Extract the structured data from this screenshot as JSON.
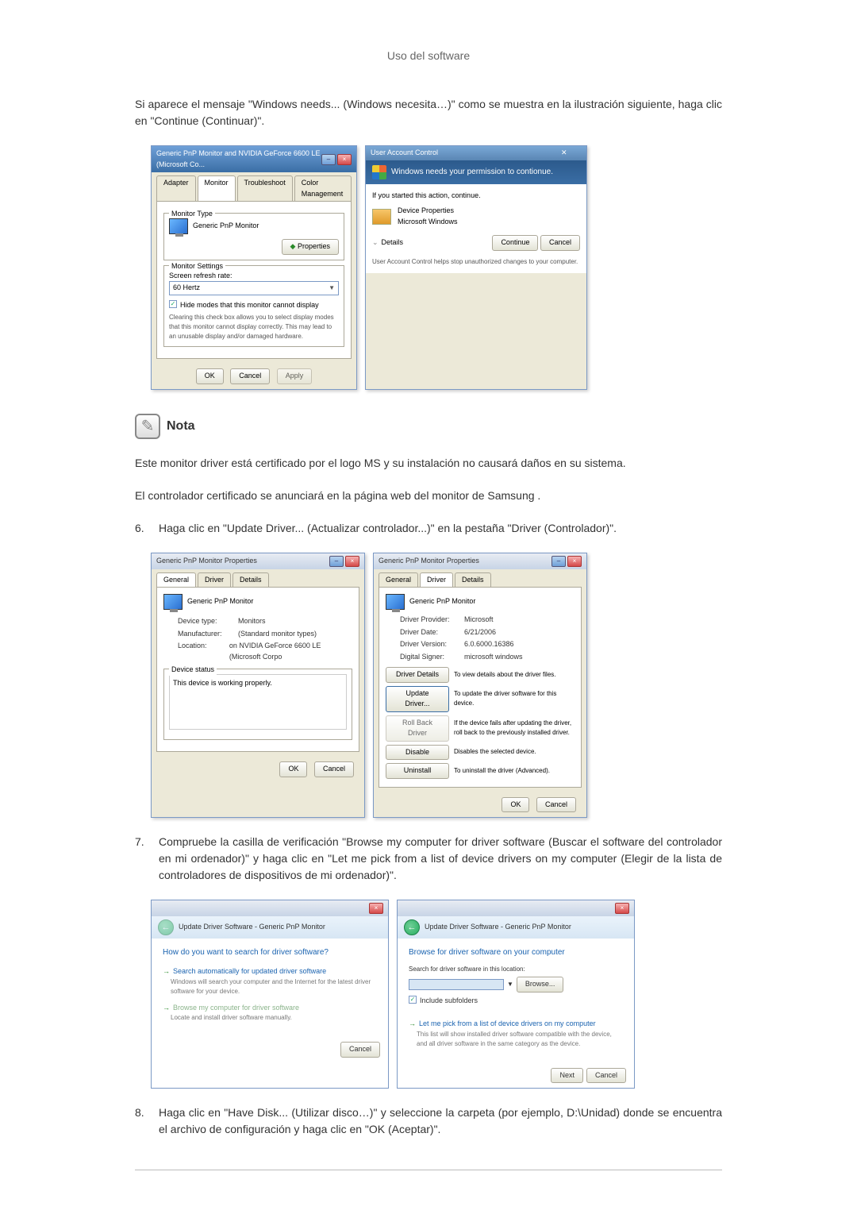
{
  "header": {
    "title": "Uso del software"
  },
  "intro": "Si aparece el mensaje \"Windows needs... (Windows necesita…)\" como se muestra en la ilustración siguiente, haga clic en \"Continue (Continuar)\".",
  "monitorDialog": {
    "title": "Generic PnP Monitor and NVIDIA GeForce 6600 LE (Microsoft Co...",
    "tabs": {
      "adapter": "Adapter",
      "monitor": "Monitor",
      "troubleshoot": "Troubleshoot",
      "color": "Color Management"
    },
    "monitorTypeLegend": "Monitor Type",
    "monitorName": "Generic PnP Monitor",
    "propertiesBtn": "Properties",
    "settingsLegend": "Monitor Settings",
    "refreshLabel": "Screen refresh rate:",
    "refreshValue": "60 Hertz",
    "hideModes": "Hide modes that this monitor cannot display",
    "hideModesDesc": "Clearing this check box allows you to select display modes that this monitor cannot display correctly. This may lead to an unusable display and/or damaged hardware.",
    "ok": "OK",
    "cancel": "Cancel",
    "apply": "Apply"
  },
  "uac": {
    "title": "User Account Control",
    "headline": "Windows needs your permission to contionue.",
    "startedAction": "If you started this action, continue.",
    "deviceProps": "Device Properties",
    "msWindows": "Microsoft Windows",
    "details": "Details",
    "continue": "Continue",
    "cancel": "Cancel",
    "helpText": "User Account Control helps stop unauthorized changes to your computer."
  },
  "note": {
    "heading": "Nota",
    "p1": "Este monitor driver está certificado por el logo MS y su instalación no causará daños en su sistema.",
    "p2": "El controlador certificado se anunciará en la página web del monitor de Samsung ."
  },
  "step6": {
    "num": "6.",
    "text": "Haga clic en \"Update Driver... (Actualizar controlador...)\" en la pestaña \"Driver (Controlador)\"."
  },
  "propsGeneral": {
    "title": "Generic PnP Monitor Properties",
    "tabs": {
      "general": "General",
      "driver": "Driver",
      "details": "Details"
    },
    "name": "Generic PnP Monitor",
    "deviceType": {
      "label": "Device type:",
      "value": "Monitors"
    },
    "manufacturer": {
      "label": "Manufacturer:",
      "value": "(Standard monitor types)"
    },
    "location": {
      "label": "Location:",
      "value": "on NVIDIA GeForce 6600 LE (Microsoft Corpo"
    },
    "statusLegend": "Device status",
    "statusText": "This device is working properly.",
    "ok": "OK",
    "cancel": "Cancel"
  },
  "propsDriver": {
    "title": "Generic PnP Monitor Properties",
    "tabs": {
      "general": "General",
      "driver": "Driver",
      "details": "Details"
    },
    "name": "Generic PnP Monitor",
    "provider": {
      "label": "Driver Provider:",
      "value": "Microsoft"
    },
    "date": {
      "label": "Driver Date:",
      "value": "6/21/2006"
    },
    "version": {
      "label": "Driver Version:",
      "value": "6.0.6000.16386"
    },
    "signer": {
      "label": "Digital Signer:",
      "value": "microsoft windows"
    },
    "driverDetails": {
      "btn": "Driver Details",
      "desc": "To view details about the driver files."
    },
    "updateDriver": {
      "btn": "Update Driver...",
      "desc": "To update the driver software for this device."
    },
    "rollback": {
      "btn": "Roll Back Driver",
      "desc": "If the device fails after updating the driver, roll back to the previously installed driver."
    },
    "disable": {
      "btn": "Disable",
      "desc": "Disables the selected device."
    },
    "uninstall": {
      "btn": "Uninstall",
      "desc": "To uninstall the driver (Advanced)."
    },
    "ok": "OK",
    "cancel": "Cancel"
  },
  "step7": {
    "num": "7.",
    "text": "Compruebe la casilla de verificación \"Browse my computer for driver software (Buscar el software del controlador en mi ordenador)\" y haga clic en \"Let me pick from a list of device drivers on my computer (Elegir de la lista de controladores de dispositivos de mi ordenador)\"."
  },
  "wizard1": {
    "title": "Update Driver Software - Generic PnP Monitor",
    "heading": "How do you want to search for driver software?",
    "opt1": {
      "title": "Search automatically for updated driver software",
      "desc": "Windows will search your computer and the Internet for the latest driver software for your device."
    },
    "opt2": {
      "title": "Browse my computer for driver software",
      "desc": "Locate and install driver software manually."
    },
    "cancel": "Cancel"
  },
  "wizard2": {
    "title": "Update Driver Software - Generic PnP Monitor",
    "heading": "Browse for driver software on your computer",
    "searchLabel": "Search for driver software in this location:",
    "browse": "Browse...",
    "include": "Include subfolders",
    "opt": {
      "title": "Let me pick from a list of device drivers on my computer",
      "desc": "This list will show installed driver software compatible with the device, and all driver software in the same category as the device."
    },
    "next": "Next",
    "cancel": "Cancel"
  },
  "step8": {
    "num": "8.",
    "text": "Haga clic en \"Have Disk... (Utilizar disco…)\" y seleccione la carpeta (por ejemplo, D:\\Unidad) donde se encuentra el archivo de configuración y haga clic en \"OK (Aceptar)\"."
  }
}
